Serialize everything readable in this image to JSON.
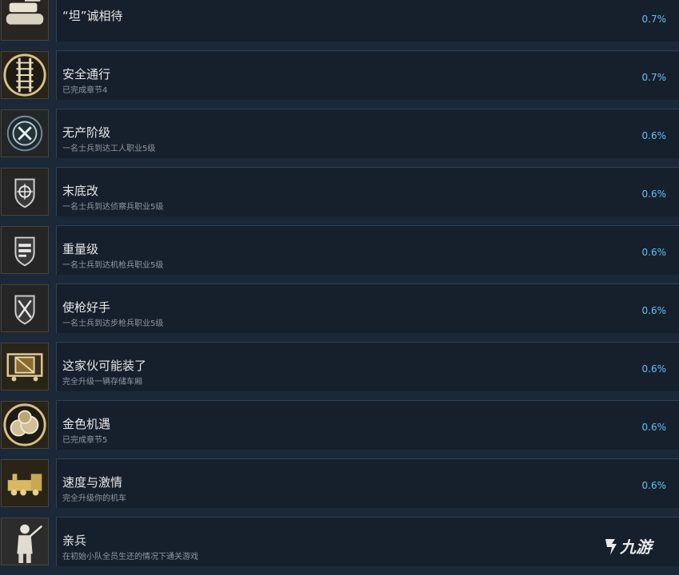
{
  "accent_color": "#66c0f4",
  "achievements": [
    {
      "title": "“坦”诚相待",
      "description": "",
      "percent": "0.7%",
      "icon": "tank-icon"
    },
    {
      "title": "安全通行",
      "description": "已完成章节4",
      "percent": "0.7%",
      "icon": "rail-track-icon"
    },
    {
      "title": "无产阶级",
      "description": "一名士兵到达工人职业5级",
      "percent": "0.6%",
      "icon": "tools-badge-icon"
    },
    {
      "title": "末底改",
      "description": "一名士兵到达侦察兵职业5级",
      "percent": "0.6%",
      "icon": "scout-badge-icon"
    },
    {
      "title": "重量级",
      "description": "一名士兵到达机枪兵职业5级",
      "percent": "0.6%",
      "icon": "machinegunner-badge-icon"
    },
    {
      "title": "使枪好手",
      "description": "一名士兵到达步枪兵职业5级",
      "percent": "0.6%",
      "icon": "rifleman-badge-icon"
    },
    {
      "title": "这家伙可能装了",
      "description": "完全升级一辆存储车厢",
      "percent": "0.6%",
      "icon": "storage-car-icon"
    },
    {
      "title": "金色机遇",
      "description": "已完成章节5",
      "percent": "0.6%",
      "icon": "gold-coins-icon"
    },
    {
      "title": "速度与激情",
      "description": "完全升级你的机车",
      "percent": "0.6%",
      "icon": "locomotive-icon"
    },
    {
      "title": "亲兵",
      "description": "在初始小队全员生还的情况下通关游戏",
      "percent": "",
      "icon": "soldier-icon"
    }
  ],
  "watermark": {
    "text": "九游",
    "icon": "jiuyou-logo-icon"
  }
}
